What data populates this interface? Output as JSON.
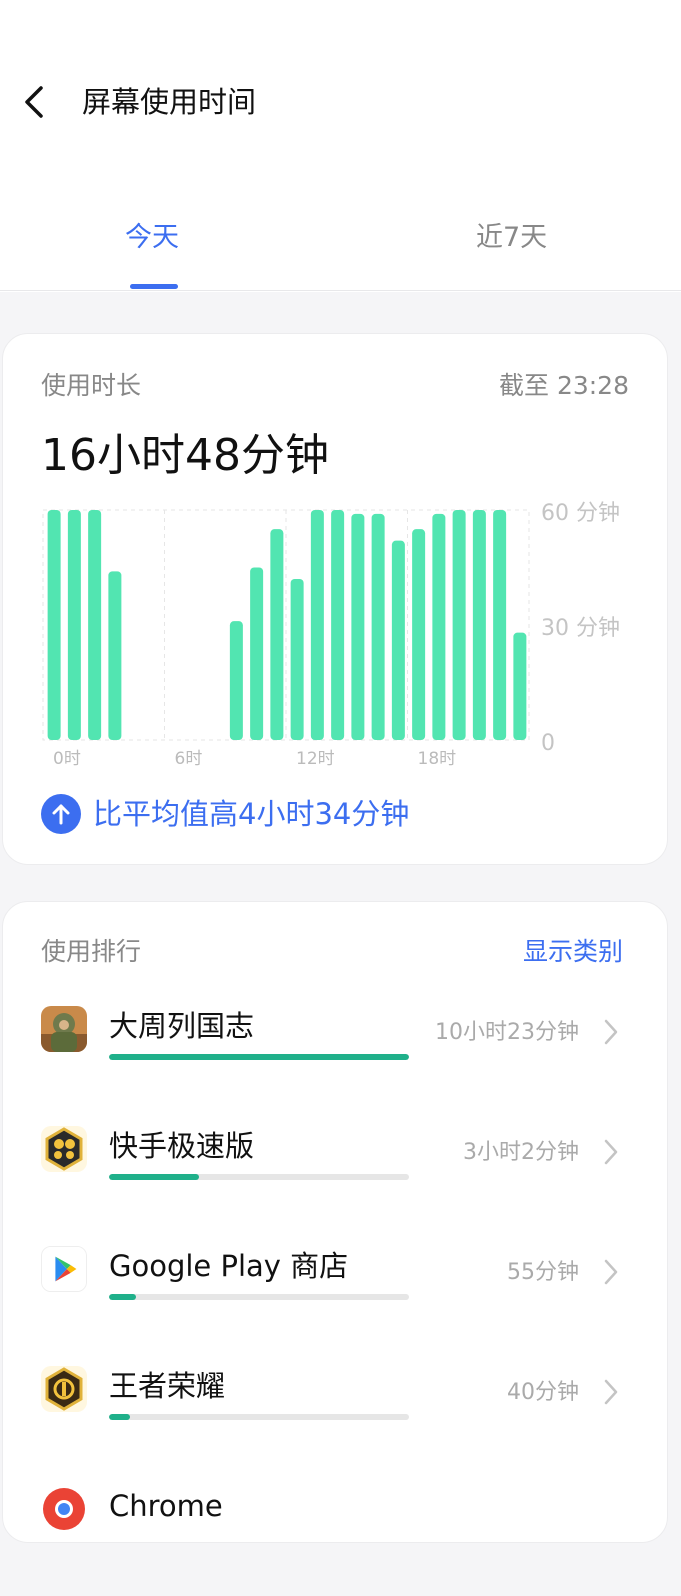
{
  "header": {
    "title": "屏幕使用时间",
    "tabs": [
      {
        "label": "今天",
        "active": true
      },
      {
        "label": "近7天",
        "active": false
      }
    ]
  },
  "usage": {
    "label": "使用时长",
    "until": "截至 23:28",
    "total": "16小时48分钟",
    "compare_text": "比平均值高4小时34分钟"
  },
  "chart_data": {
    "type": "bar",
    "ylim": [
      0,
      60
    ],
    "y_tick_labels": [
      "60 分钟",
      "30 分钟",
      "0"
    ],
    "y_tick_values": [
      60,
      30,
      0
    ],
    "x_tick_labels": [
      "0时",
      "6时",
      "12时",
      "18时"
    ],
    "x_tick_hours": [
      0,
      6,
      12,
      18
    ],
    "categories": [
      "0",
      "1",
      "2",
      "3",
      "4",
      "5",
      "6",
      "7",
      "8",
      "9",
      "10",
      "11",
      "12",
      "13",
      "14",
      "15",
      "16",
      "17",
      "18",
      "19",
      "20",
      "21",
      "22",
      "23"
    ],
    "values": [
      60,
      60,
      60,
      44,
      0,
      0,
      0,
      0,
      0,
      31,
      45,
      55,
      42,
      60,
      60,
      59,
      59,
      52,
      55,
      59,
      60,
      60,
      60,
      28
    ],
    "color": "#52e5b1",
    "grid": true
  },
  "ranking": {
    "label": "使用排行",
    "show_category": "显示类别",
    "apps": [
      {
        "name": "大周列国志",
        "time": "10小时23分钟",
        "fraction": 1.0,
        "icon": "game-warrior-icon"
      },
      {
        "name": "快手极速版",
        "time": "3小时2分钟",
        "fraction": 0.3,
        "icon": "kuaishou-icon"
      },
      {
        "name": "Google Play 商店",
        "time": "55分钟",
        "fraction": 0.09,
        "icon": "google-play-icon"
      },
      {
        "name": "王者荣耀",
        "time": "40分钟",
        "fraction": 0.07,
        "icon": "honor-of-kings-icon"
      },
      {
        "name": "Chrome",
        "time": "",
        "fraction": 0.05,
        "icon": "chrome-icon"
      }
    ]
  },
  "colors": {
    "accent": "#3c6ef0",
    "bar": "#52e5b1",
    "progress": "#1fb08a"
  }
}
